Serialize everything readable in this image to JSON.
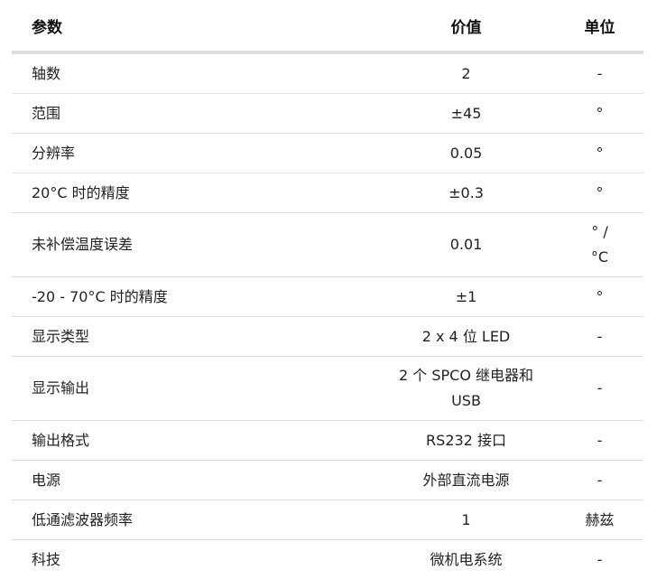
{
  "header": {
    "param": "参数",
    "value": "价值",
    "unit": "单位"
  },
  "rows": [
    {
      "param": "轴数",
      "value": "2",
      "unit": "-"
    },
    {
      "param": "范围",
      "value": "±45",
      "unit": "°"
    },
    {
      "param": "分辨率",
      "value": "0.05",
      "unit": "°"
    },
    {
      "param": "20°C 时的精度",
      "value": "±0.3",
      "unit": "°"
    },
    {
      "param": "未补偿温度误差",
      "value": "0.01",
      "unit": "° / °C"
    },
    {
      "param": "-20 - 70°C 时的精度",
      "value": "±1",
      "unit": "°"
    },
    {
      "param": "显示类型",
      "value": "2 x 4 位 LED",
      "unit": "-"
    },
    {
      "param": "显示输出",
      "value": "2 个 SPCO 继电器和 USB",
      "unit": "-"
    },
    {
      "param": "输出格式",
      "value": "RS232 接口",
      "unit": "-"
    },
    {
      "param": "电源",
      "value": "外部直流电源",
      "unit": "-"
    },
    {
      "param": "低通滤波器频率",
      "value": "1",
      "unit": "赫兹"
    },
    {
      "param": "科技",
      "value": "微机电系统",
      "unit": "-"
    }
  ]
}
